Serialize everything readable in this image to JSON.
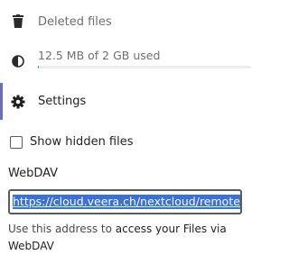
{
  "nav": {
    "deleted_files": {
      "label": "Deleted files",
      "icon": "trash-icon"
    },
    "quota": {
      "label": "12.5 MB of 2 GB used",
      "icon": "pie-chart-icon",
      "used_fraction": 0.006
    },
    "settings": {
      "label": "Settings",
      "icon": "gear-icon",
      "active": true
    }
  },
  "settings_panel": {
    "show_hidden_files": {
      "label": "Show hidden files",
      "checked": false
    },
    "webdav": {
      "title": "WebDAV",
      "url": "https://cloud.veera.ch/nextcloud/remote.php/dav/files/",
      "hint_prefix": "Use this address to ",
      "hint_link": "access your Files via WebDAV"
    }
  },
  "colors": {
    "active_marker": "#6a6fb7",
    "selection": "#3b6fd9",
    "quota_fill": "#0082c9"
  }
}
